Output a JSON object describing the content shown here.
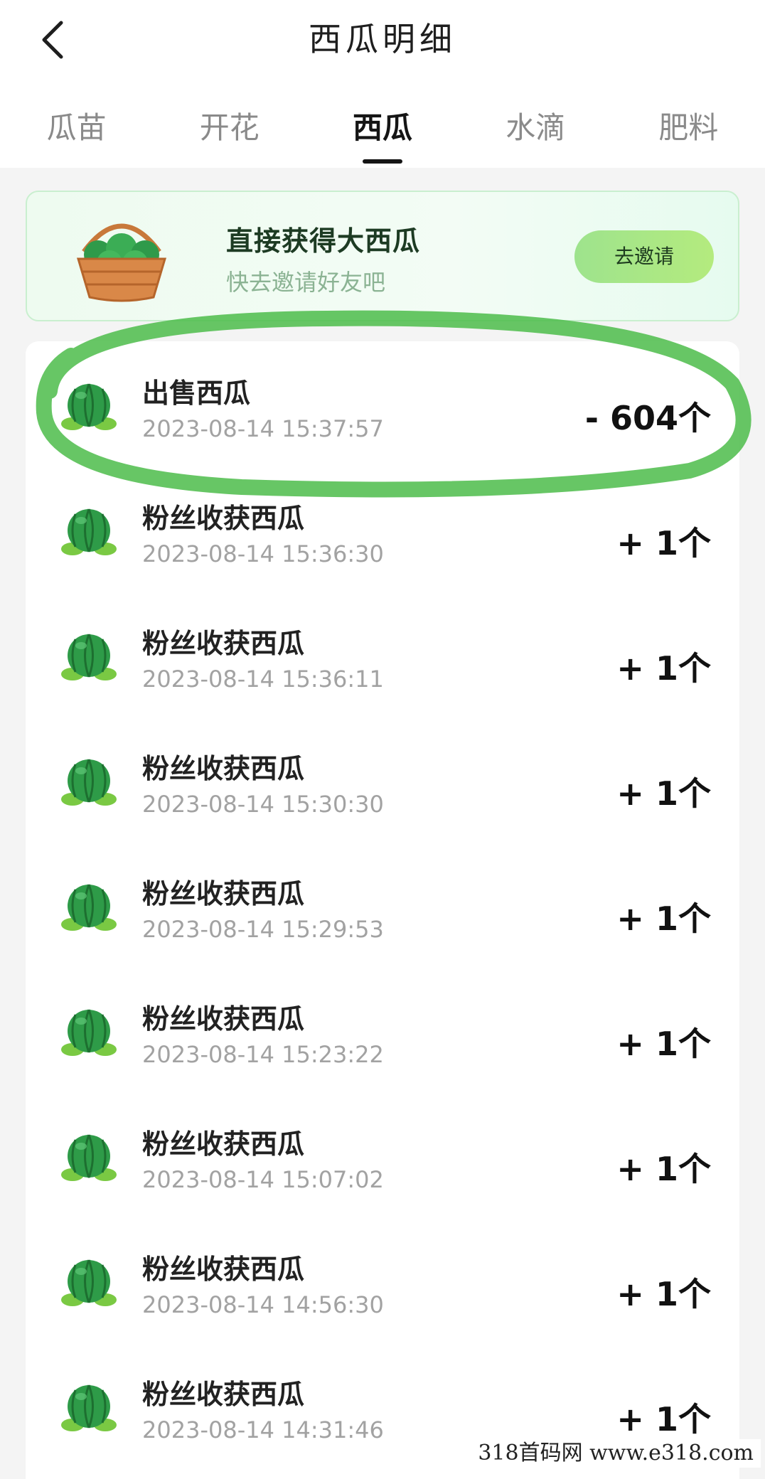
{
  "header": {
    "title": "西瓜明细"
  },
  "tabs": [
    {
      "label": "瓜苗",
      "active": false
    },
    {
      "label": "开花",
      "active": false
    },
    {
      "label": "西瓜",
      "active": true
    },
    {
      "label": "水滴",
      "active": false
    },
    {
      "label": "肥料",
      "active": false
    }
  ],
  "banner": {
    "title": "直接获得大西瓜",
    "subtitle": "快去邀请好友吧",
    "button_label": "去邀请"
  },
  "records": [
    {
      "name": "出售西瓜",
      "time": "2023-08-14 15:37:57",
      "amount": "- 604个"
    },
    {
      "name": "粉丝收获西瓜",
      "time": "2023-08-14 15:36:30",
      "amount": "+ 1个"
    },
    {
      "name": "粉丝收获西瓜",
      "time": "2023-08-14 15:36:11",
      "amount": "+ 1个"
    },
    {
      "name": "粉丝收获西瓜",
      "time": "2023-08-14 15:30:30",
      "amount": "+ 1个"
    },
    {
      "name": "粉丝收获西瓜",
      "time": "2023-08-14 15:29:53",
      "amount": "+ 1个"
    },
    {
      "name": "粉丝收获西瓜",
      "time": "2023-08-14 15:23:22",
      "amount": "+ 1个"
    },
    {
      "name": "粉丝收获西瓜",
      "time": "2023-08-14 15:07:02",
      "amount": "+ 1个"
    },
    {
      "name": "粉丝收获西瓜",
      "time": "2023-08-14 14:56:30",
      "amount": "+ 1个"
    },
    {
      "name": "粉丝收获西瓜",
      "time": "2023-08-14 14:31:46",
      "amount": "+ 1个"
    }
  ],
  "watermark": "318首码网 www.e318.com",
  "colors": {
    "accent_green": "#5dbb55",
    "highlight_stroke": "#4cbc4a",
    "button_gradient_start": "#9ee38d",
    "button_gradient_end": "#b4eb7e"
  },
  "icons": {
    "back": "chevron-left-icon",
    "basket": "watermelon-basket-icon",
    "record": "watermelon-icon"
  }
}
